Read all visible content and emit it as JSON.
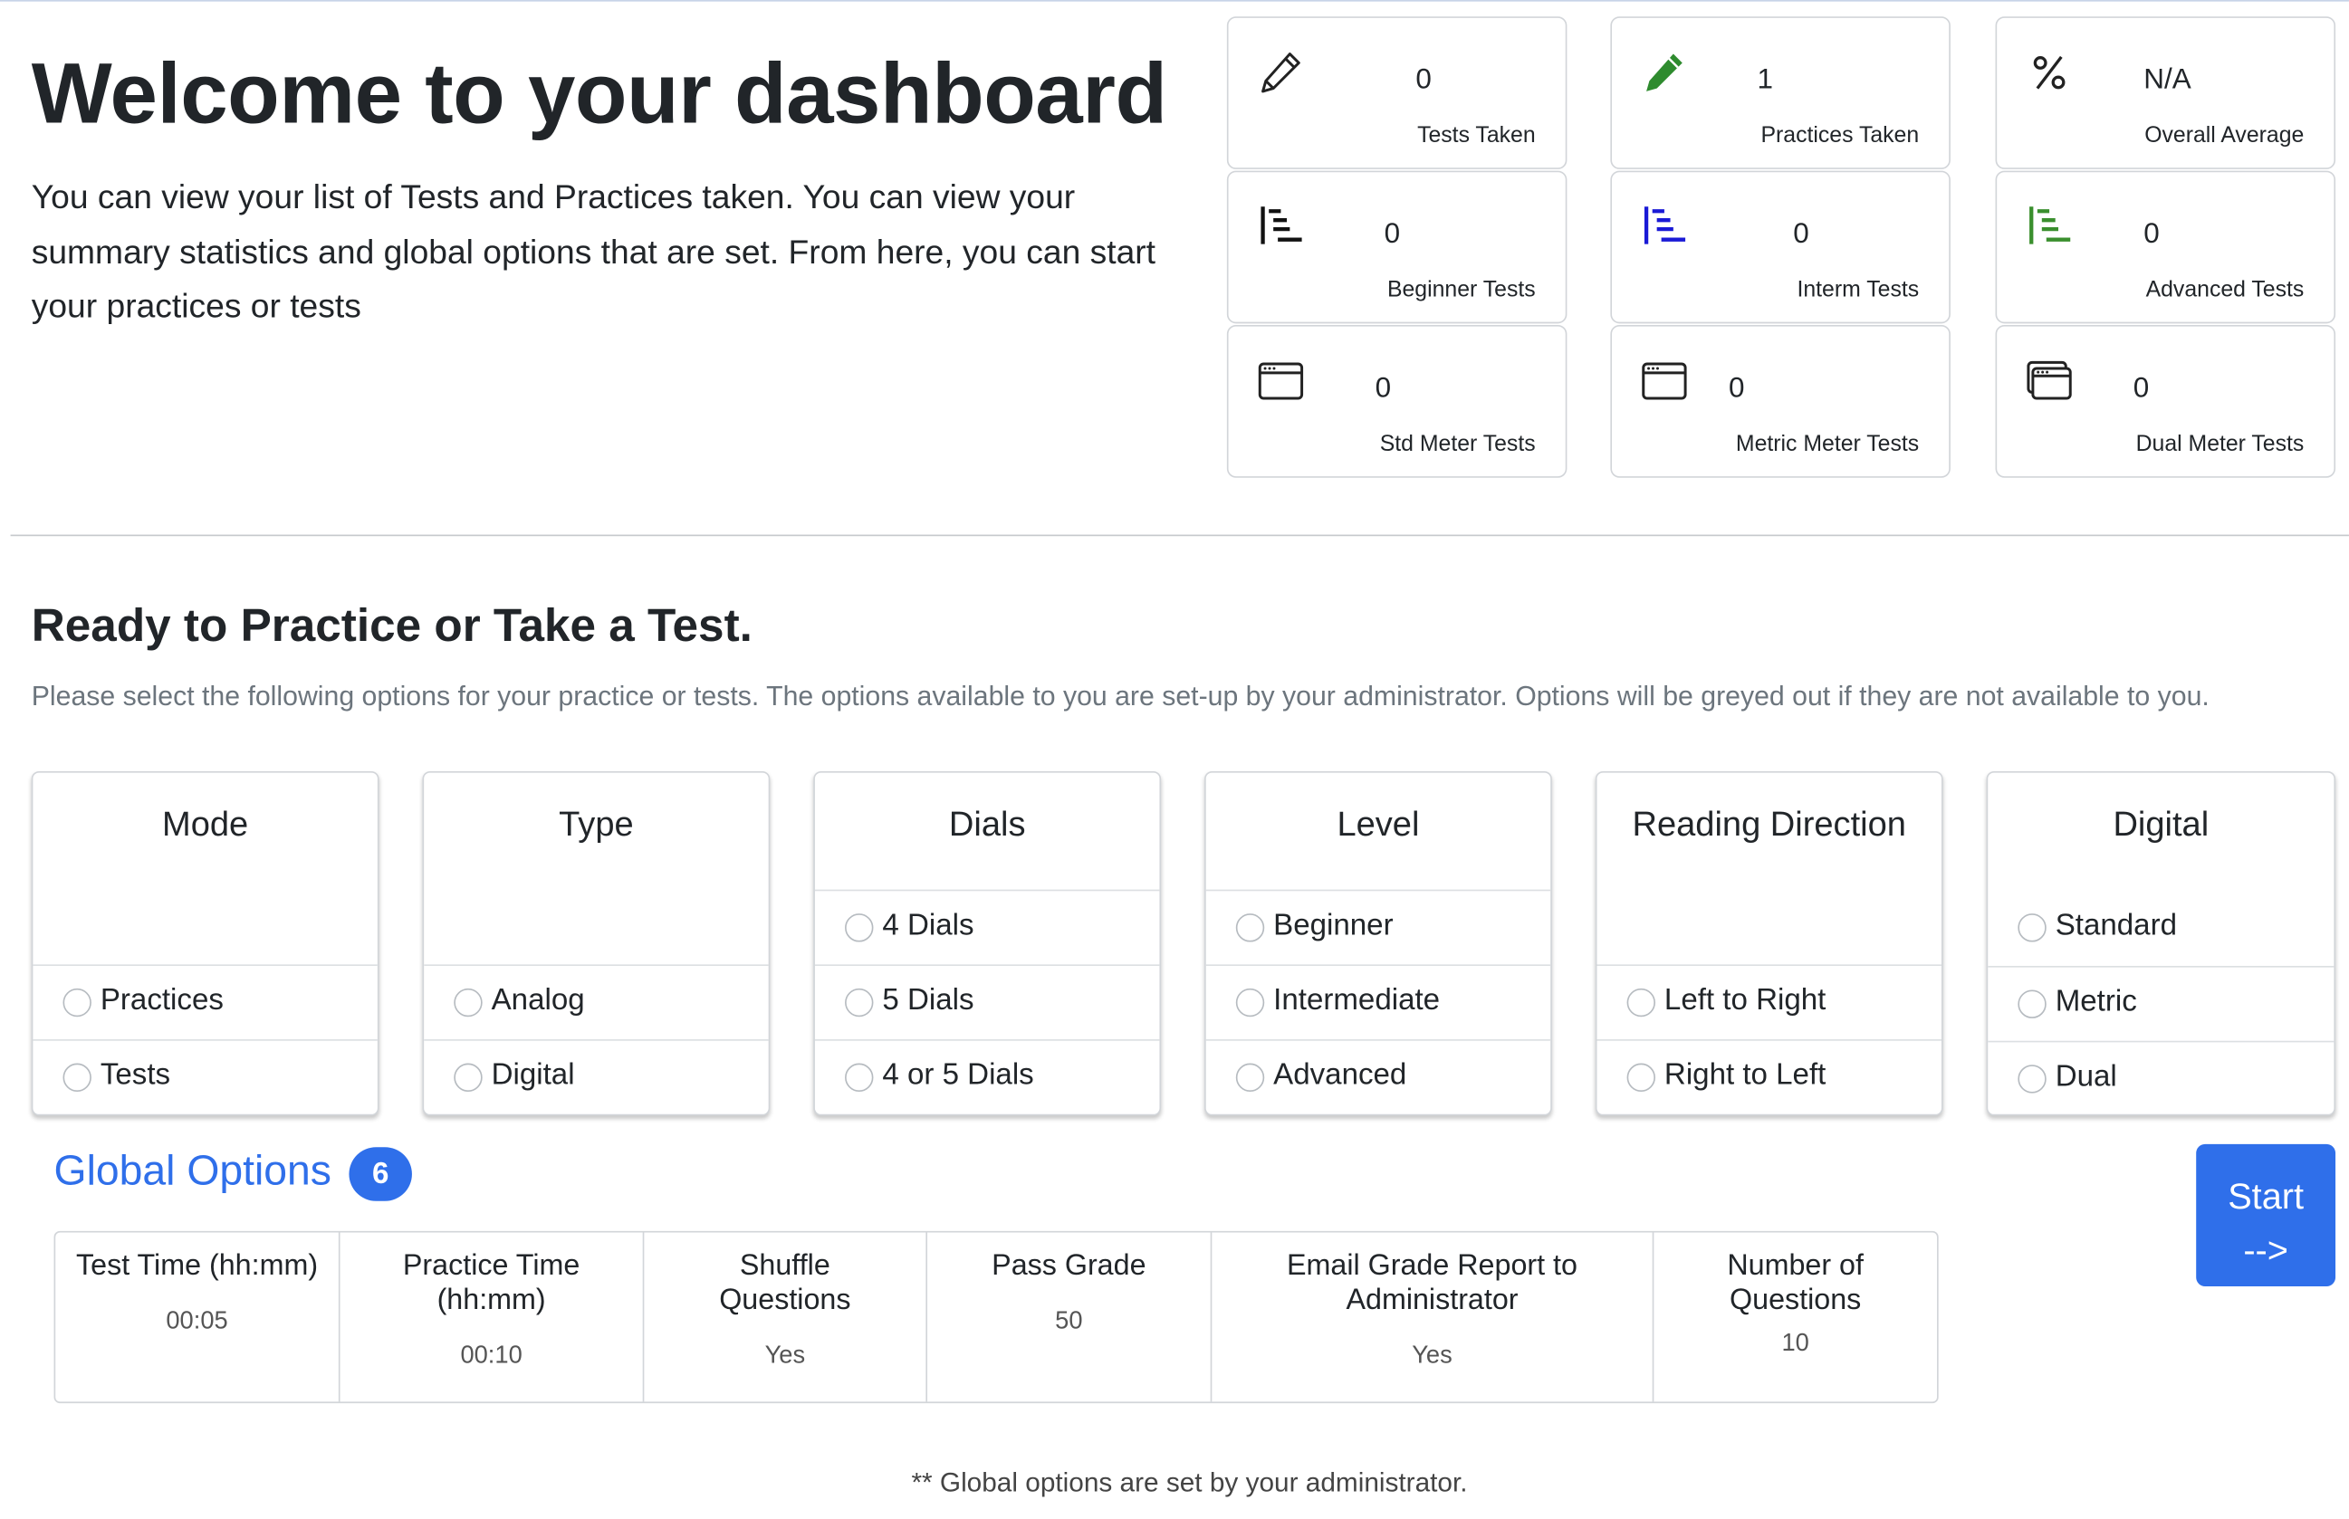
{
  "hero": {
    "title": "Welcome to your dashboard",
    "description": "You can view your list of Tests and Practices taken. You can view your summary statistics and global options that are set. From here, you can start your practices or tests"
  },
  "stats": [
    {
      "icon": "pencil-icon",
      "value": "0",
      "label": "Tests Taken"
    },
    {
      "icon": "pencil-fill-icon",
      "value": "1",
      "label": "Practices Taken",
      "color": "#2e8b2e"
    },
    {
      "icon": "percent-icon",
      "value": "N/A",
      "label": "Overall Average"
    },
    {
      "icon": "list-indent-icon",
      "value": "0",
      "label": "Beginner Tests",
      "color": "#111111"
    },
    {
      "icon": "list-indent-icon",
      "value": "0",
      "label": "Interm Tests",
      "color": "#1a1ad6"
    },
    {
      "icon": "list-indent-icon",
      "value": "0",
      "label": "Advanced Tests",
      "color": "#3a8f2e"
    },
    {
      "icon": "window-icon",
      "value": "0",
      "label": "Std Meter Tests"
    },
    {
      "icon": "window-icon",
      "value": "0",
      "label": "Metric Meter Tests"
    },
    {
      "icon": "window-stack-icon",
      "value": "0",
      "label": "Dual Meter Tests"
    }
  ],
  "practice": {
    "title": "Ready to Practice or Take a Test.",
    "description": "Please select the following options for your practice or tests. The options available to you are set-up by your administrator. Options will be greyed out if they are not available to you."
  },
  "cards": [
    {
      "title": "Mode",
      "options": [
        "Practices",
        "Tests"
      ]
    },
    {
      "title": "Type",
      "options": [
        "Analog",
        "Digital"
      ]
    },
    {
      "title": "Dials",
      "options": [
        "4 Dials",
        "5 Dials",
        "4 or 5 Dials"
      ]
    },
    {
      "title": "Level",
      "options": [
        "Beginner",
        "Intermediate",
        "Advanced"
      ]
    },
    {
      "title": "Reading Direction",
      "options": [
        "Left to Right",
        "Right to Left"
      ]
    },
    {
      "title": "Digital",
      "options": [
        "Standard",
        "Metric",
        "Dual"
      ]
    }
  ],
  "global_options": {
    "title": "Global Options",
    "badge": "6",
    "columns": [
      {
        "header": "Test Time (hh:mm)",
        "value": "00:05"
      },
      {
        "header": "Practice Time (hh:mm)",
        "value": "00:10"
      },
      {
        "header": "Shuffle Questions",
        "value": "Yes"
      },
      {
        "header": "Pass Grade",
        "value": "50"
      },
      {
        "header": "Email Grade Report to Administrator",
        "value": "Yes"
      },
      {
        "header": "Number of Questions",
        "value": "10"
      }
    ],
    "footnote": "** Global options are set by your administrator."
  },
  "start_button": {
    "line1": "Start",
    "line2": "-->"
  },
  "colors": {
    "accent": "#2f6fea",
    "border": "#d2d5d9"
  }
}
